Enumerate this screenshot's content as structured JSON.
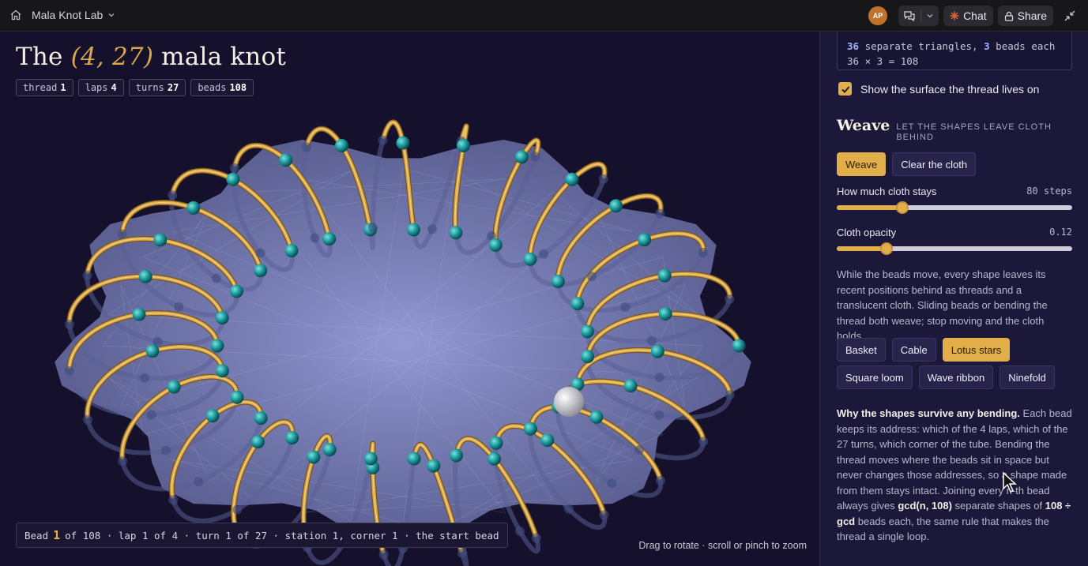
{
  "topbar": {
    "app_title": "Mala Knot Lab",
    "avatar_initials": "AP",
    "chat_label": "Chat",
    "share_label": "Share",
    "accent": "#c0722a"
  },
  "main": {
    "title_prefix": "The ",
    "title_math": "(4, 27)",
    "title_suffix": " mala knot",
    "chips": [
      {
        "label": "thread",
        "value": "1"
      },
      {
        "label": "laps",
        "value": "4"
      },
      {
        "label": "turns",
        "value": "27"
      },
      {
        "label": "beads",
        "value": "108"
      }
    ],
    "status": {
      "prefix": "Bead",
      "bead_index": "1",
      "rest": "of 108 · lap 1 of 4 · turn 1 of 27 · station 1, corner 1 · the start bead"
    },
    "hint": "Drag to rotate · scroll or pinch to zoom",
    "colors": {
      "thread": "#d9a84a",
      "bead": "#1a9a9c",
      "cloth": "#8d97dc"
    }
  },
  "panel": {
    "code_line1_n1": "36",
    "code_line1_t1": " separate triangles, ",
    "code_line1_n2": "3",
    "code_line1_t2": " beads each",
    "code_line2": "36 × 3 = 108",
    "surface_checkbox_label": "Show the surface the thread lives on",
    "surface_checked": true,
    "weave_title": "Weave",
    "weave_subtitle": "LET THE SHAPES LEAVE CLOTH BEHIND",
    "weave_button": "Weave",
    "clear_button": "Clear the cloth",
    "slider_cloth_stays": {
      "label": "How much cloth stays",
      "value_text": "80 steps",
      "fraction": 0.28
    },
    "slider_opacity": {
      "label": "Cloth opacity",
      "value_text": "0.12",
      "fraction": 0.21
    },
    "description": "While the beads move, every shape leaves its recent positions behind as threads and a translucent cloth. Sliding beads or bending the thread both weave; stop moving and the cloth holds.",
    "patterns": [
      "Basket",
      "Cable",
      "Lotus stars",
      "Square loom",
      "Wave ribbon",
      "Ninefold"
    ],
    "active_pattern": "Lotus stars",
    "why_heading": "Why the shapes survive any bending.",
    "why_p1": " Each bead keeps its address: which of the 4 laps, which of the 27 turns, which corner of the tube. Bending the thread moves where the beads sit in space but never changes those addresses, so a shape made from them stays intact. Joining every n-th bead always gives ",
    "why_b1": "gcd(n, 108)",
    "why_p2": " separate shapes of ",
    "why_b2": "108 ÷ gcd",
    "why_p3": " beads each, the same rule that makes the thread a single loop."
  }
}
